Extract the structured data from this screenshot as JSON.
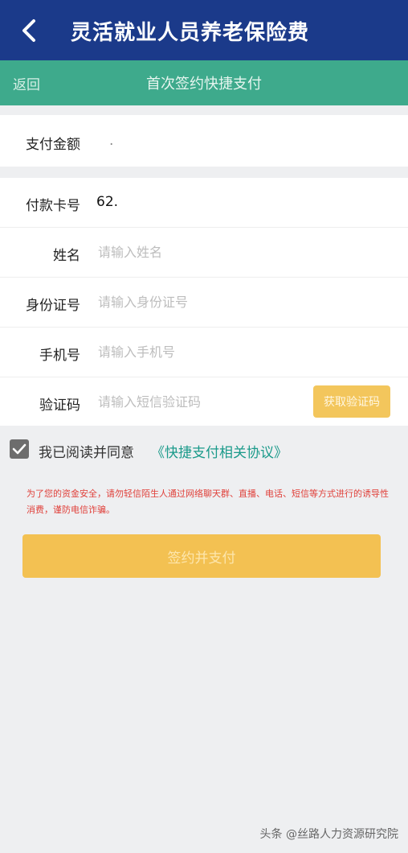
{
  "header": {
    "title": "灵活就业人员养老保险费"
  },
  "subheader": {
    "back_label": "返回",
    "title": "首次签约快捷支付"
  },
  "amount": {
    "label": "支付金额",
    "value": "."
  },
  "form": {
    "card_label": "付款卡号",
    "card_value": "62.",
    "name_label": "姓名",
    "name_placeholder": "请输入姓名",
    "id_label": "身份证号",
    "id_placeholder": "请输入身份证号",
    "phone_label": "手机号",
    "phone_placeholder": "请输入手机号",
    "code_label": "验证码",
    "code_placeholder": "请输入短信验证码",
    "code_button": "获取验证码"
  },
  "agreement": {
    "text": "我已阅读并同意",
    "link": "《快捷支付相关协议》",
    "checked": true
  },
  "warning": "为了您的资金安全，请勿轻信陌生人通过网络聊天群、直播、电话、短信等方式进行的诱导性消费，谨防电信诈骗。",
  "submit_label": "签约并支付",
  "watermark": "头条 @丝路人力资源研究院",
  "colors": {
    "header_bg": "#1b3a8a",
    "subheader_bg": "#3eaa8c",
    "accent": "#f3c152",
    "link": "#1a9a8a",
    "warning": "#e0413b"
  }
}
